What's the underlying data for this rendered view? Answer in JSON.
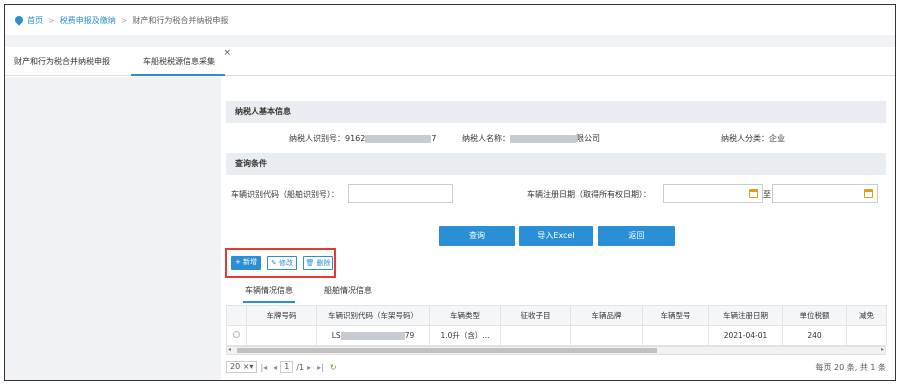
{
  "breadcrumb": {
    "home": "首页",
    "level1": "税费申报及缴纳",
    "level2": "财产和行为税合并纳税申报"
  },
  "tabs": [
    {
      "label": "财产和行为税合并纳税申报"
    },
    {
      "label": "车船税税源信息采集",
      "close": "×"
    }
  ],
  "taxpayer": {
    "section_title": "纳税人基本信息",
    "id_label": "纳税人识别号：",
    "id_prefix": "9162",
    "id_suffix": "7",
    "name_label": "纳税人名称：",
    "name_suffix": "限公司",
    "category_label": "纳税人分类：",
    "category_value": "企业"
  },
  "query": {
    "section_title": "查询条件",
    "vin_label": "车辆识别代码（船舶识别号）：",
    "vin_value": "",
    "reg_date_label": "车辆注册日期（取得所有权日期）：",
    "date_from": "",
    "date_to": "",
    "to_word": "至"
  },
  "buttons": {
    "query": "查询",
    "import_excel": "导入Excel",
    "back": "返回"
  },
  "actions": {
    "add": "+ 新增",
    "edit": "修改",
    "delete": "删除"
  },
  "subtabs": [
    "车辆情况信息",
    "船舶情况信息"
  ],
  "grid": {
    "columns": [
      "",
      "车牌号码",
      "车辆识别代码（车架号码）",
      "车辆类型",
      "征收子目",
      "车辆品牌",
      "车辆型号",
      "车辆注册日期",
      "单位税额",
      "减免"
    ],
    "rows": [
      {
        "plate": "",
        "vin_prefix": "LS",
        "vin_suffix": "79",
        "type": "1.0升（含）...",
        "item": "",
        "brand": "",
        "model": "",
        "reg_date": "2021-04-01",
        "unit_tax": "240",
        "relief": ""
      }
    ]
  },
  "pager": {
    "page_size": "20",
    "page": "1",
    "total_pages": "/1",
    "summary": "每页 20 条, 共 1 条"
  },
  "colors": {
    "accent": "#2b8fd6",
    "highlight": "#e53935"
  }
}
